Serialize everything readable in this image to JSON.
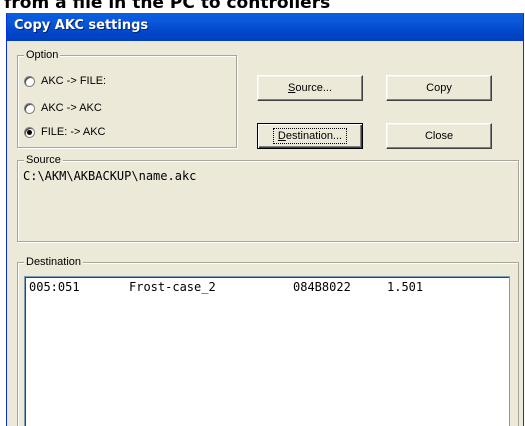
{
  "page_heading": "from a file in the PC to controllers",
  "window": {
    "title": "Copy AKC settings"
  },
  "option_group": {
    "legend": "Option",
    "radios": [
      {
        "label": "AKC  -> FILE:",
        "checked": false
      },
      {
        "label": "AKC  -> AKC",
        "checked": false
      },
      {
        "label": "FILE: -> AKC",
        "checked": true
      }
    ]
  },
  "buttons": {
    "source": {
      "mnemonic": "S",
      "rest": "ource..."
    },
    "copy": "Copy",
    "destination": {
      "mnemonic": "D",
      "rest": "estination..."
    },
    "close": "Close"
  },
  "source_group": {
    "legend": "Source",
    "path": "C:\\AKM\\AKBACKUP\\name.akc"
  },
  "destination_group": {
    "legend": "Destination",
    "rows": [
      {
        "address": "005:051",
        "name": "Frost-case_2",
        "code": "084B8022",
        "version": "1.501"
      }
    ]
  }
}
